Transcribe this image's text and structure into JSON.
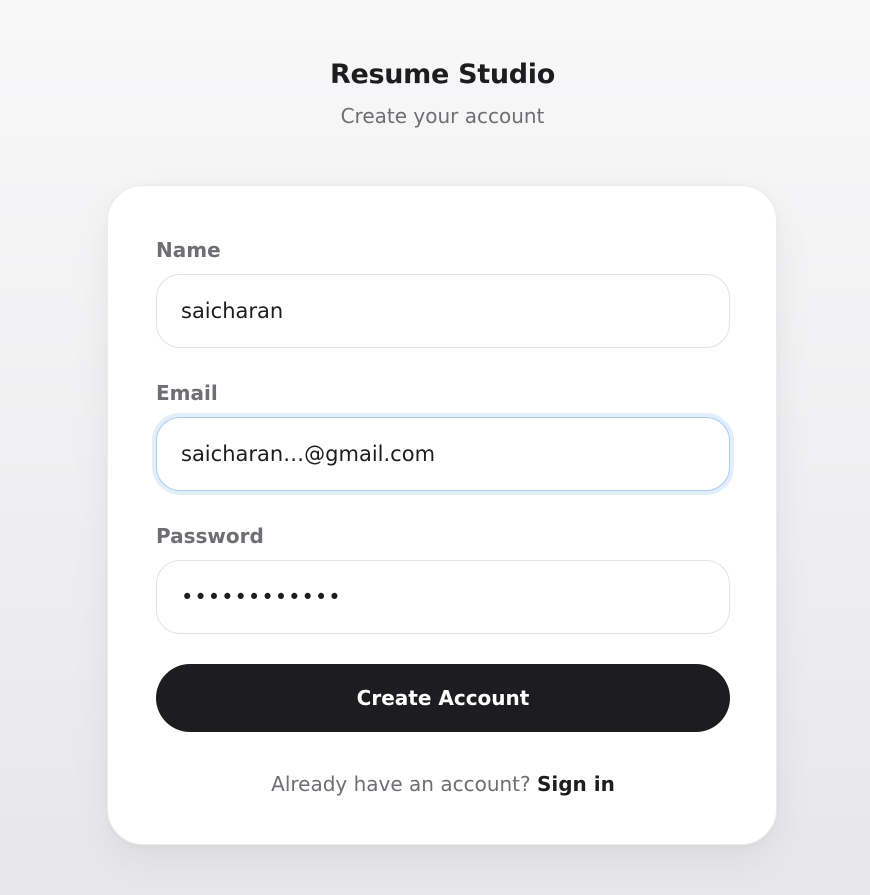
{
  "header": {
    "title": "Resume Studio",
    "subtitle": "Create your account"
  },
  "form": {
    "name": {
      "label": "Name",
      "value": "saicharan"
    },
    "email": {
      "label": "Email",
      "value": "saicharan…@gmail.com"
    },
    "password": {
      "label": "Password",
      "value": "••••••••••••"
    },
    "submit_label": "Create Account"
  },
  "footer": {
    "prompt": "Already have an account?",
    "link_label": "Sign in"
  },
  "colors": {
    "primary": "#1d1d1f",
    "muted": "#6e6e73",
    "focus_ring": "#a8cdf0"
  }
}
